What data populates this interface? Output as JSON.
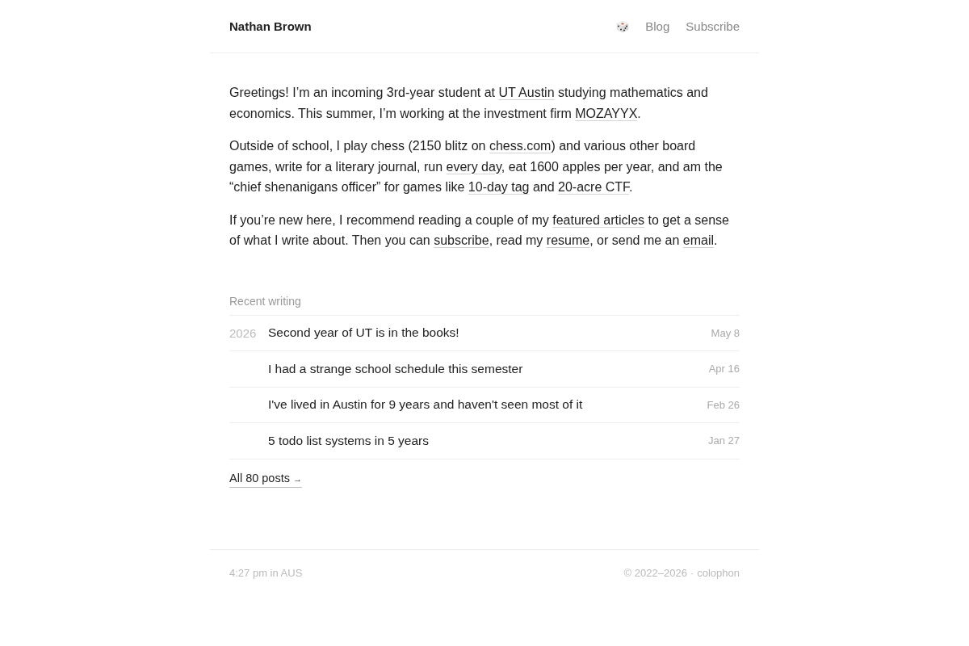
{
  "header": {
    "site_title": "Nathan Brown",
    "nav": [
      {
        "label": "Blog"
      },
      {
        "label": "Subscribe"
      }
    ]
  },
  "intro": [
    [
      {
        "kind": "text",
        "text": "Greetings! I’m an incoming 3rd-year student at "
      },
      {
        "kind": "link",
        "text": "UT Austin"
      },
      {
        "kind": "text",
        "text": " studying mathematics and economics. This summer, I’m working at the investment firm "
      },
      {
        "kind": "link",
        "text": "MOZAYYX"
      },
      {
        "kind": "text",
        "text": "."
      }
    ],
    [
      {
        "kind": "text",
        "text": "Outside of school, I play chess (2150 blitz on "
      },
      {
        "kind": "link",
        "text": "chess.com"
      },
      {
        "kind": "text",
        "text": ") and various other board games, write for a literary journal, run "
      },
      {
        "kind": "link",
        "text": "every day"
      },
      {
        "kind": "text",
        "text": ", eat 1600 apples per year, and am the “chief shenanigans officer” for games like "
      },
      {
        "kind": "link",
        "text": "10-day tag"
      },
      {
        "kind": "text",
        "text": " and "
      },
      {
        "kind": "link",
        "text": "20-acre CTF"
      },
      {
        "kind": "text",
        "text": "."
      }
    ],
    [
      {
        "kind": "text",
        "text": "If you’re new here, I recommend reading a couple of my "
      },
      {
        "kind": "link",
        "text": "featured articles"
      },
      {
        "kind": "text",
        "text": " to get a sense of what I write about. Then you can "
      },
      {
        "kind": "link",
        "text": "subscribe"
      },
      {
        "kind": "text",
        "text": ", read my "
      },
      {
        "kind": "link",
        "text": "resume"
      },
      {
        "kind": "text",
        "text": ", or send me an "
      },
      {
        "kind": "link",
        "text": "email"
      },
      {
        "kind": "text",
        "text": "."
      }
    ]
  ],
  "recent_writing": {
    "heading": "Recent writing",
    "posts": [
      {
        "year": "2026",
        "title": "Second year of UT is in the books!",
        "date": "May 8"
      },
      {
        "title": "I had a strange school schedule this semester",
        "date": "Apr 16"
      },
      {
        "title": "I've lived in Austin for 9 years and haven't seen most of it",
        "date": "Feb 26"
      },
      {
        "title": "5 todo list systems in 5 years",
        "date": "Jan 27"
      }
    ],
    "all_posts_link": {
      "label": "All 80 posts",
      "arrow": "→"
    }
  },
  "footer": {
    "local_time": "4:27 pm in AUS",
    "copyright": "© 2022–2026",
    "separator": "·",
    "colophon_link": "colophon"
  }
}
